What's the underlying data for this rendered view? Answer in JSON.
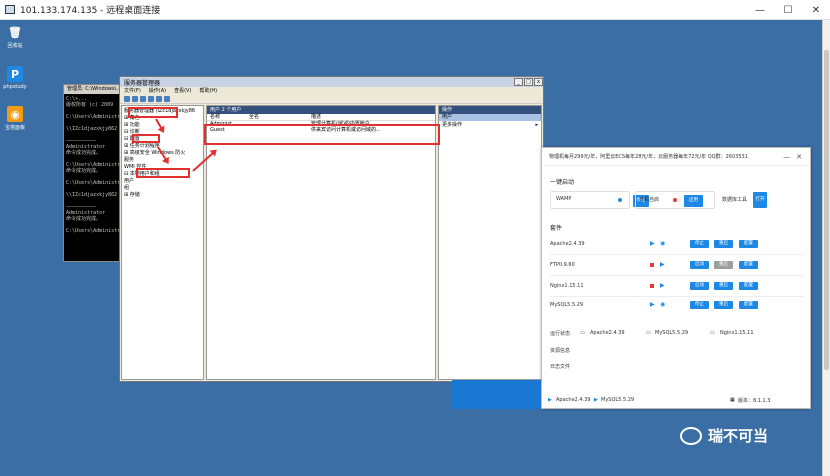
{
  "rdp": {
    "title": "101.133.174.135 - 远程桌面连接"
  },
  "desktop_icons": [
    {
      "label": "回收站",
      "glyph": "🗑",
      "color": "#ffffff00"
    },
    {
      "label": "phpstudy",
      "glyph": "P",
      "color": "#1e88e5"
    },
    {
      "label": "宝塔面板",
      "glyph": "◉",
      "color": "#f39c12"
    }
  ],
  "cmd": {
    "title": "管理员: C:\\Windows\\...",
    "lines": [
      "C:\\>...",
      "版权所有 (c) 2009",
      "",
      "C:\\Users\\Administr",
      "",
      "\\\\IZc1djazxkjy862",
      "",
      "——————————",
      "Administrator",
      "命令成功完成。",
      "",
      "C:\\Users\\Administr",
      "命令成功完成。",
      "",
      "C:\\Users\\Administr",
      "",
      "\\\\IZc1djazxkjy862",
      "",
      "——————————",
      "Administrator",
      "命令成功完成。",
      "",
      "C:\\Users\\Administr"
    ]
  },
  "server_manager": {
    "title": "服务器管理器",
    "menu": [
      "文件(F)",
      "操作(A)",
      "查看(V)",
      "帮助(H)"
    ],
    "tree": [
      "服务器管理器 (iZc1djazxkjy86",
      "⊞ 角色",
      "⊞ 功能",
      "⊟ 诊断",
      "⊟ 配置",
      "  ⊞ 任务计划程序",
      "  ⊞ 高级安全 Windows 防火",
      "    服务",
      "    WMI 控件",
      "  ⊟ 本地用户和组",
      "      用户",
      "      组",
      "⊞ 存储"
    ],
    "list_header": "用户    2 个用户",
    "columns": [
      "名称",
      "全名",
      "描述"
    ],
    "rows": [
      {
        "name": "Administ...",
        "full": "",
        "desc": "管理计算机(域)的内置帐户"
      },
      {
        "name": "Guest",
        "full": "",
        "desc": "供来宾访问计算机或访问域的..."
      }
    ],
    "actions_header": "操作",
    "actions_sub": "用户",
    "actions_item": "更多操作"
  },
  "phpstudy": {
    "notice": "物理机每月299元/年，阿里云ECS每年28元/年，云服务器每年72元/年 QQ群：2603531",
    "quick": "一键启动",
    "wamp": "WAMP",
    "stop": "停止",
    "boot": "开机自启",
    "enable": "启用",
    "dbtool": "数据库工具",
    "open": "打开",
    "suite": "套件",
    "services": [
      {
        "name": "Apache2.4.39",
        "running": true,
        "b1": "停止",
        "b2": "重启",
        "b3": "配置"
      },
      {
        "name": "FTP0.9.60",
        "running": false,
        "b1": "启动",
        "b2": "重启",
        "b3": "配置"
      },
      {
        "name": "Nginx1.15.11",
        "running": false,
        "b1": "启动",
        "b2": "重启",
        "b3": "配置"
      },
      {
        "name": "MySQL5.5.29",
        "running": true,
        "b1": "停止",
        "b2": "重启",
        "b3": "配置"
      }
    ],
    "running_label": "运行状态",
    "running_items": [
      "Apache2.4.39",
      "MySQL5.5.29",
      "Nginx1.15.11"
    ],
    "resource_label": "资源信息",
    "log_label": "日志文件",
    "footer_items": [
      "Apache2.4.39",
      "MySQL5.5.29"
    ],
    "version": "版本：8.1.1.3"
  },
  "wechat": "瑞不可当"
}
